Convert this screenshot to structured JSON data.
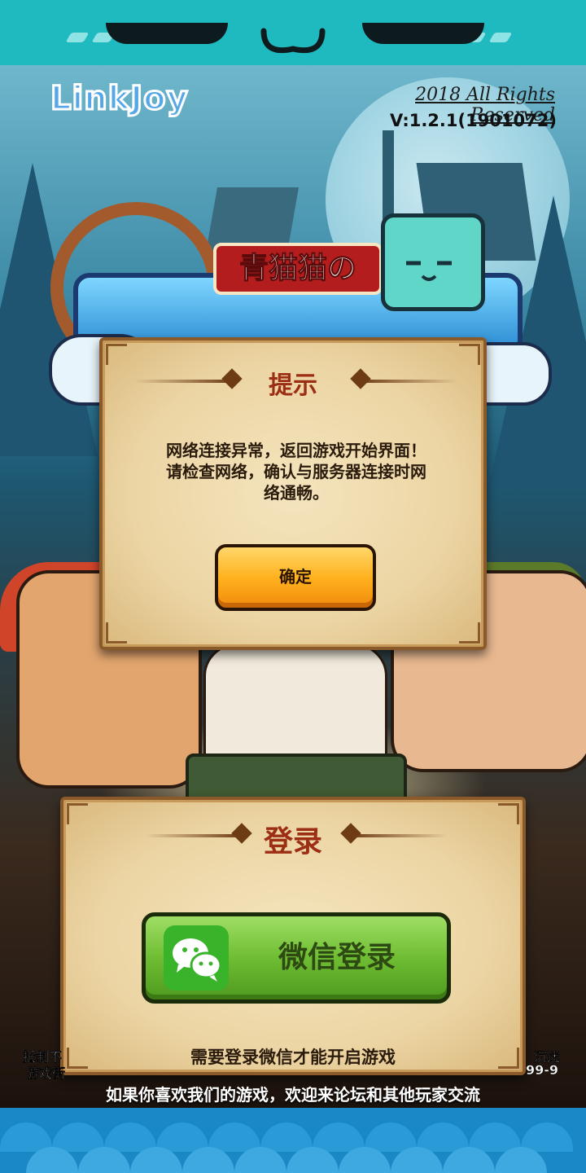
{
  "header": {
    "logo": "LinkJoy",
    "rights": "2018 All Rights Reserved",
    "version": "V:1.2.1(1901072)"
  },
  "game_title": {
    "banner": "青猫猫の"
  },
  "dialog": {
    "title": "提示",
    "message": "网络连接异常，返回游戏开始界面！\n请检查网络，确认与服务器连接时网\n络通畅。",
    "confirm_label": "确定"
  },
  "login": {
    "title": "登录",
    "wechat_button_label": "微信登录",
    "hint": "需要登录微信才能开启游戏"
  },
  "footer": {
    "left_partial_1": "抵制不",
    "left_partial_2": "游戏街",
    "right_partial_1": "沉迷",
    "right_partial_2": "99-9",
    "forum_text": "如果你喜欢我们的游戏，欢迎来论坛和其他玩家交流"
  },
  "colors": {
    "top_bar": "#1fb9c0",
    "bottom_bar": "#1b88c6",
    "confirm_button": "#ffb21e",
    "wechat_button": "#6fbd33",
    "panel_title": "#9c2e14"
  },
  "icons": {
    "wechat": "wechat-icon"
  }
}
